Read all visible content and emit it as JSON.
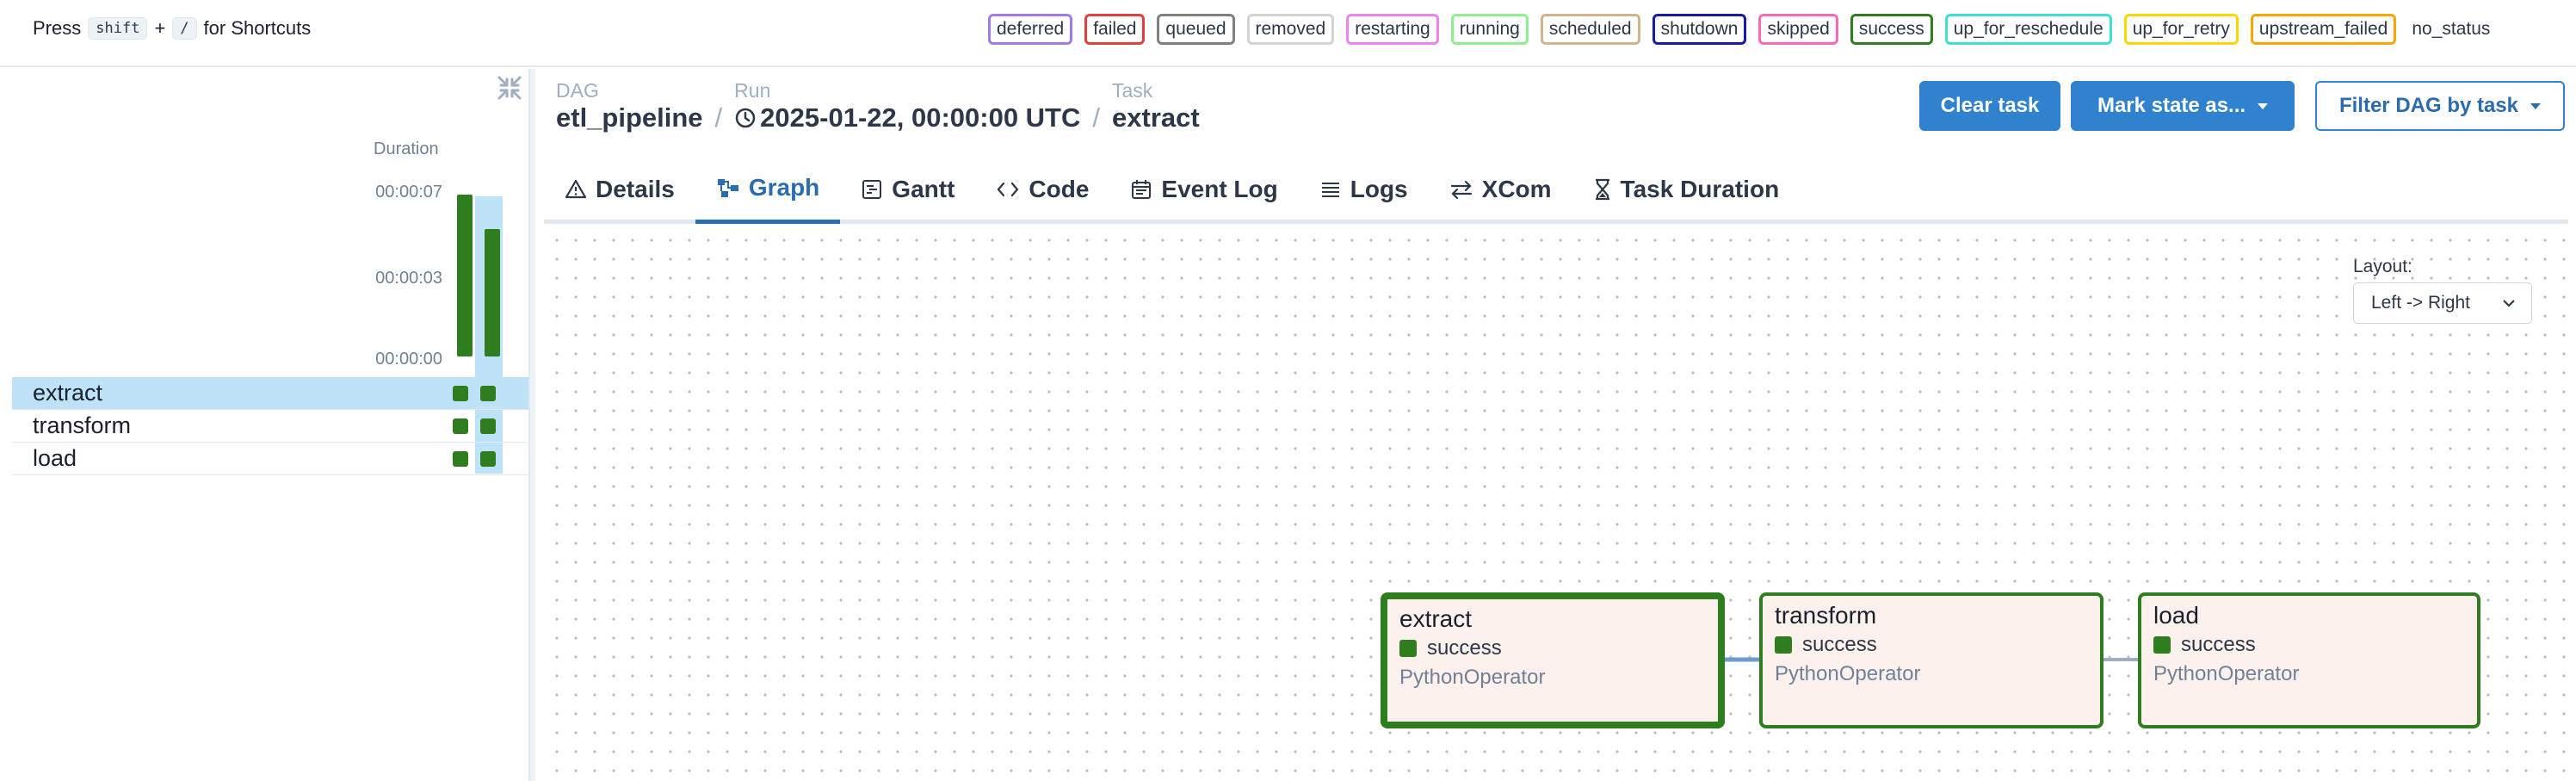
{
  "shortcut_hint": {
    "prefix": "Press",
    "key1": "shift",
    "plus": "+",
    "key2": "/",
    "suffix": "for Shortcuts"
  },
  "legend": [
    {
      "label": "deferred",
      "color": "#9f7aea"
    },
    {
      "label": "failed",
      "color": "#e53e3e"
    },
    {
      "label": "queued",
      "color": "#808080"
    },
    {
      "label": "removed",
      "color": "#d3d3d3"
    },
    {
      "label": "restarting",
      "color": "#ee82ee"
    },
    {
      "label": "running",
      "color": "#90ee90"
    },
    {
      "label": "scheduled",
      "color": "#d2b48c"
    },
    {
      "label": "shutdown",
      "color": "#1a1aa8"
    },
    {
      "label": "skipped",
      "color": "#ff69b4"
    },
    {
      "label": "success",
      "color": "#2e7d1e"
    },
    {
      "label": "up_for_reschedule",
      "color": "#40e0d0"
    },
    {
      "label": "up_for_retry",
      "color": "#ffd700"
    },
    {
      "label": "upstream_failed",
      "color": "#ffa500"
    },
    {
      "label": "no_status",
      "color": ""
    }
  ],
  "grid": {
    "duration_title": "Duration",
    "ticks": [
      "00:00:07",
      "00:00:03",
      "00:00:00"
    ],
    "run_durations": [
      7,
      5.5
    ],
    "tasks": [
      "extract",
      "transform",
      "load"
    ],
    "selected_task": "extract"
  },
  "breadcrumb": {
    "dag_key": "DAG",
    "dag_value": "etl_pipeline",
    "run_key": "Run",
    "run_value": "2025-01-22, 00:00:00 UTC",
    "task_key": "Task",
    "task_value": "extract",
    "separator": "/"
  },
  "actions": {
    "clear": "Clear task",
    "mark": "Mark state as...",
    "filter": "Filter DAG by task"
  },
  "tabs": [
    {
      "label": "Details",
      "icon": "warning-triangle-icon"
    },
    {
      "label": "Graph",
      "icon": "graph-icon"
    },
    {
      "label": "Gantt",
      "icon": "gantt-icon"
    },
    {
      "label": "Code",
      "icon": "code-icon"
    },
    {
      "label": "Event Log",
      "icon": "calendar-icon"
    },
    {
      "label": "Logs",
      "icon": "list-icon"
    },
    {
      "label": "XCom",
      "icon": "swap-arrows-icon"
    },
    {
      "label": "Task Duration",
      "icon": "hourglass-icon"
    }
  ],
  "active_tab": "Graph",
  "layout": {
    "label": "Layout:",
    "value": "Left -> Right"
  },
  "graph_nodes": [
    {
      "name": "extract",
      "state": "success",
      "operator": "PythonOperator"
    },
    {
      "name": "transform",
      "state": "success",
      "operator": "PythonOperator"
    },
    {
      "name": "load",
      "state": "success",
      "operator": "PythonOperator"
    }
  ]
}
